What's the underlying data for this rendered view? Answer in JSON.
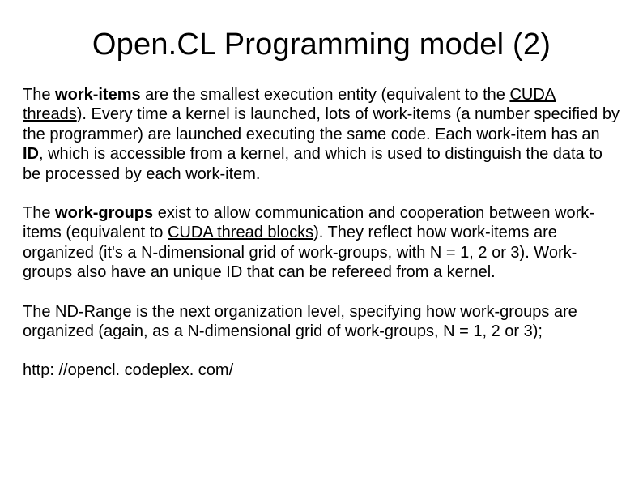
{
  "title": "Open.CL Programming model (2)",
  "p1": {
    "t1": "The ",
    "b1": "work-items",
    "t2": " are the smallest execution entity (equivalent to the ",
    "u1": "CUDA threads",
    "t3": "). Every time a kernel is launched, lots of work-items (a number specified by the programmer) are launched executing the same code. Each work-item has an ",
    "b2": "ID",
    "t4": ", which is accessible from a kernel, and which is used to distinguish the data to be processed by each work-item."
  },
  "p2": {
    "t1": "The ",
    "b1": "work-groups",
    "t2": " exist to allow communication and cooperation between work-items (equivalent to ",
    "u1": "CUDA thread blocks",
    "t3": "). They reflect how work-items are organized (it's a N-dimensional grid of work-groups, with N = 1, 2 or 3). Work-groups also have an unique ID that can be refereed from a kernel."
  },
  "p3": {
    "t1": "The ND-Range is the next organization level, specifying how work-groups are organized (again, as a N-dimensional grid of work-groups, N = 1, 2 or 3);"
  },
  "url": "http: //opencl. codeplex. com/"
}
